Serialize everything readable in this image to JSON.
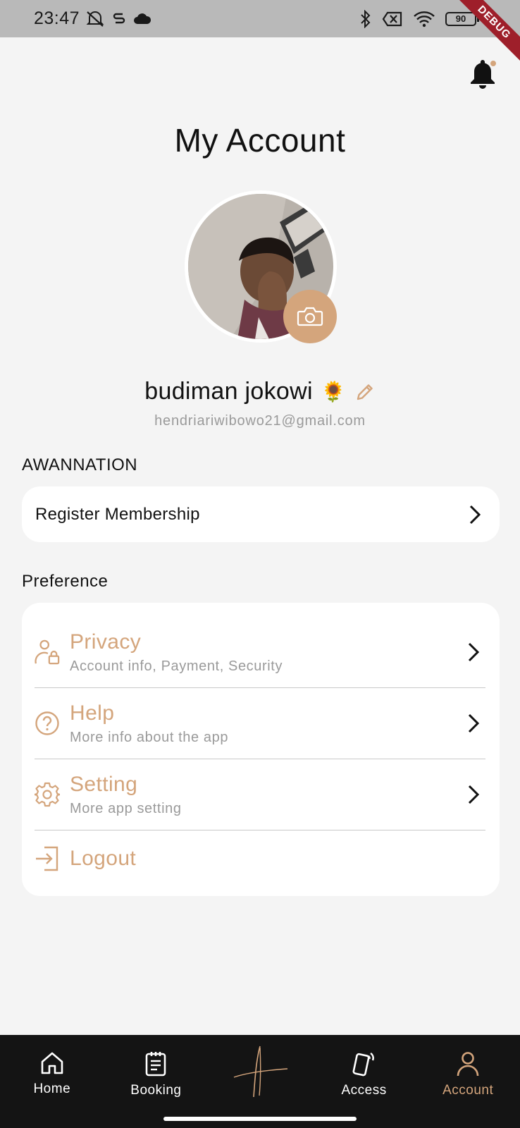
{
  "status_bar": {
    "time": "23:47",
    "battery": "90",
    "debug_label": "DEBUG",
    "icons": [
      "dnd-icon",
      "s-icon",
      "cloud-icon",
      "bluetooth-icon",
      "no-sim-icon",
      "wifi-icon",
      "battery-icon"
    ]
  },
  "header": {
    "title": "My Account",
    "notification_badge": true
  },
  "profile": {
    "name": "budiman jokowi",
    "name_emoji": "🌻",
    "email": "hendriariwibowo21@gmail.com"
  },
  "membership_section": {
    "label": "AWANNATION",
    "item_label": "Register Membership"
  },
  "preference_section": {
    "label": "Preference",
    "items": [
      {
        "title": "Privacy",
        "subtitle": "Account info, Payment, Security",
        "icon": "user-lock-icon"
      },
      {
        "title": "Help",
        "subtitle": "More info about the app",
        "icon": "help-circle-icon"
      },
      {
        "title": "Setting",
        "subtitle": "More app setting",
        "icon": "gear-icon"
      },
      {
        "title": "Logout",
        "icon": "logout-icon"
      }
    ]
  },
  "bottom_nav": {
    "items": [
      {
        "label": "Home",
        "icon": "home-icon"
      },
      {
        "label": "Booking",
        "icon": "booking-icon"
      },
      {
        "label": "",
        "icon": "brand-logo"
      },
      {
        "label": "Access",
        "icon": "access-phone-icon"
      },
      {
        "label": "Account",
        "icon": "account-icon"
      }
    ],
    "active": "Account"
  },
  "colors": {
    "accent": "#d4a57c",
    "background": "#f4f4f4",
    "nav_background": "#141414"
  }
}
